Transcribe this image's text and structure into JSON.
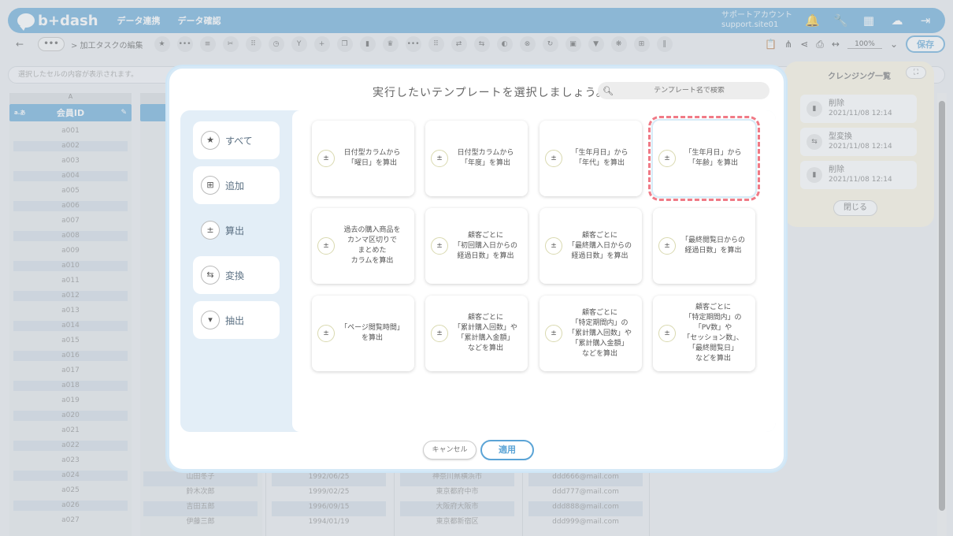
{
  "app": {
    "logo_text": "b+dash",
    "nav": [
      "データ連携",
      "データ確認"
    ],
    "account_label": "サポートアカウント",
    "account_site": "support.site01"
  },
  "toolbar": {
    "back": "←",
    "more": "•••",
    "breadcrumb": "> 加工タスクの編集",
    "zoom": "100%",
    "save_label": "保存"
  },
  "cellbar": {
    "placeholder": "選択したセルの内容が表示されます。"
  },
  "grid": {
    "col_letter_a": "A",
    "col_header_a": "会員ID",
    "col_kind": "a.あ",
    "ids": [
      "a001",
      "a002",
      "a003",
      "a004",
      "a005",
      "a006",
      "a007",
      "a008",
      "a009",
      "a010",
      "a011",
      "a012",
      "a013",
      "a014",
      "a015",
      "a016",
      "a017",
      "a018",
      "a019",
      "a020",
      "a021",
      "a022",
      "a023",
      "a024",
      "a025",
      "a026",
      "a027"
    ],
    "bottom_rows": [
      {
        "name": "山田冬子",
        "date": "1992/06/25",
        "pref": "神奈川県横浜市",
        "mail": "ddd666@mail.com"
      },
      {
        "name": "鈴木次郎",
        "date": "1999/02/25",
        "pref": "東京都府中市",
        "mail": "ddd777@mail.com"
      },
      {
        "name": "吉田五郎",
        "date": "1996/09/15",
        "pref": "大阪府大阪市",
        "mail": "ddd888@mail.com"
      },
      {
        "name": "伊藤三郎",
        "date": "1994/01/19",
        "pref": "東京都新宿区",
        "mail": "ddd999@mail.com"
      }
    ]
  },
  "right_panel": {
    "title": "クレンジング一覧",
    "items": [
      {
        "action": "削除",
        "time": "2021/11/08 12:14"
      },
      {
        "action": "型変換",
        "time": "2021/11/08 12:14"
      },
      {
        "action": "削除",
        "time": "2021/11/08 12:14"
      }
    ],
    "close_label": "閉じる"
  },
  "modal": {
    "title": "実行したいテンプレートを選択しましょう。",
    "search_placeholder": "テンプレート名で検索",
    "categories": [
      {
        "label": "すべて",
        "icon": "star-icon"
      },
      {
        "label": "追加",
        "icon": "plus-box-icon"
      },
      {
        "label": "算出",
        "icon": "calc-icon"
      },
      {
        "label": "変換",
        "icon": "convert-icon"
      },
      {
        "label": "抽出",
        "icon": "filter-icon"
      }
    ],
    "active_category": "算出",
    "templates": [
      "日付型カラムから\n「曜日」を算出",
      "日付型カラムから\n「年度」を算出",
      "「生年月日」から\n「年代」を算出",
      "「生年月日」から\n「年齢」を算出",
      "過去の購入商品を\nカンマ区切りで\nまとめた\nカラムを算出",
      "顧客ごとに\n「初回購入日からの\n経過日数」を算出",
      "顧客ごとに\n「最終購入日からの\n経過日数」を算出",
      "「最終閲覧日からの\n経過日数」を算出",
      "「ページ閲覧時間」\nを算出",
      "顧客ごとに\n「累計購入回数」や\n「累計購入金額」\nなどを算出",
      "顧客ごとに\n「特定期間内」の\n「累計購入回数」や\n「累計購入金額」\nなどを算出",
      "顧客ごとに\n「特定期間内」の\n「PV数」や\n「セッション数」、\n「最終閲覧日」\nなどを算出"
    ],
    "selected_index": 3,
    "cancel_label": "キャンセル",
    "apply_label": "適用"
  },
  "colors": {
    "accent": "#5ba4d6",
    "selected_outline": "#f07a86"
  }
}
